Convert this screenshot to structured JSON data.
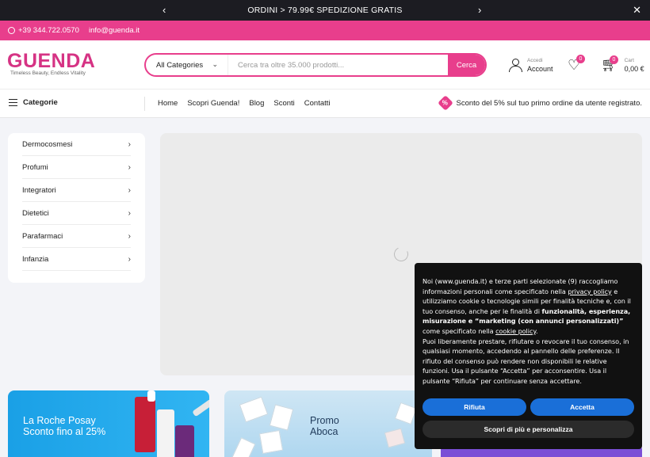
{
  "announcement": {
    "message": "ORDINI > 79.99€ SPEDIZIONE GRATIS",
    "prev_icon": "chevron-left-icon",
    "next_icon": "chevron-right-icon",
    "close_icon": "close-icon"
  },
  "contact": {
    "phone": "+39 344.722.0570",
    "email": "info@guenda.it"
  },
  "header": {
    "logo_text": "GUENDA",
    "tagline": "Timeless Beauty, Endless Vitality",
    "search": {
      "category": "All Categories",
      "placeholder": "Cerca tra oltre 35.000 prodotti...",
      "button": "Cerca"
    },
    "account": {
      "small": "Accedi",
      "label": "Account"
    },
    "wishlist_count": "0",
    "cart": {
      "small": "Cart",
      "total": "0,00 €",
      "count": "0"
    }
  },
  "nav": {
    "categories_label": "Categorie",
    "links": [
      "Home",
      "Scopri Guenda!",
      "Blog",
      "Sconti",
      "Contatti"
    ],
    "promo": "Sconto del 5% sul tuo primo ordine da utente registrato.",
    "promo_icon_text": "%"
  },
  "category_menu": [
    "Dermocosmesi",
    "Profumi",
    "Integratori",
    "Dietetici",
    "Parafarmaci",
    "Infanzia"
  ],
  "banners": [
    {
      "line1": "La Roche Posay",
      "line2": "Sconto fino al 25%"
    },
    {
      "line1": "Promo",
      "line2": "Aboca"
    }
  ],
  "cookie": {
    "p1_a": "Noi (www.guenda.it) e terze parti selezionate (9) raccogliamo informazioni personali come specificato nella ",
    "privacy_link": "privacy policy",
    "p1_b": " e utilizziamo cookie o tecnologie simili per finalità tecniche e, con il tuo consenso, anche per le finalità di ",
    "p1_bold": "funzionalità, esperienza, misurazione e “marketing (con annunci personalizzati)”",
    "p1_c": " come specificato nella ",
    "cookie_link": "cookie policy",
    "p1_d": ".",
    "p2": "Puoi liberamente prestare, rifiutare o revocare il tuo consenso, in qualsiasi momento, accedendo al pannello delle preferenze. Il rifiuto del consenso può rendere non disponibili le relative funzioni. Usa il pulsante “Accetta” per acconsentire. Usa il pulsante “Rifiuta” per continuare senza accettare.",
    "reject": "Rifiuta",
    "accept": "Accetta",
    "more": "Scopri di più e personalizza"
  }
}
